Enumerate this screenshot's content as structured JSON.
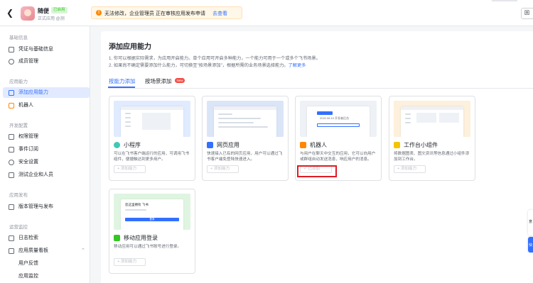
{
  "header": {
    "back_icon": "back-icon",
    "app_name": "随便",
    "app_badge": "已启用",
    "app_sub": "正式应用  @测",
    "banner_text": "无法修改，企业管理员 正在审核应用发布申请",
    "banner_link": "去查看",
    "right_button": "回"
  },
  "sidebar": {
    "groups": {
      "basic": "基础信息",
      "capability": "应用能力",
      "dev": "开发配置",
      "release": "应用发布",
      "ops": "运营监控"
    },
    "items": [
      {
        "label": "凭证与基础信息"
      },
      {
        "label": "成员管理"
      },
      {
        "label": "添加应用能力"
      },
      {
        "label": "机器人"
      },
      {
        "label": "权限管理"
      },
      {
        "label": "事件订阅"
      },
      {
        "label": "安全设置"
      },
      {
        "label": "测试企业和人员"
      },
      {
        "label": "版本管理与发布"
      },
      {
        "label": "日志检索"
      },
      {
        "label": "应用质量看板"
      },
      {
        "label": "用户反馈"
      },
      {
        "label": "应用监控"
      }
    ]
  },
  "main": {
    "title": "添加应用能力",
    "desc1": "1. 你可以根据实际需求，为应用开启能力。单个应用可开启多种能力，一个能力可用于一个或多个飞书场景。",
    "desc2": "2. 如果尚不确定需要添加什么能力，可切换至\"按场景添加\"，根据所需的业务场景选择能力。",
    "desc2_link": "了解更多",
    "tabs": [
      {
        "label": "按能力添加"
      },
      {
        "label": "按场景添加"
      }
    ],
    "new_badge": "New",
    "cards": [
      {
        "title": "小程序",
        "desc": "可以在飞书客户端运行的应用，可调用飞书组件，便捷触达到更多用户。",
        "button": "+ 添加能力"
      },
      {
        "title": "网页应用",
        "desc": "快速接入已有的网页应用，用户可以通过飞书客户端免登陆快速进入。",
        "button": "+ 添加能力"
      },
      {
        "title": "机器人",
        "desc": "与用户在聊天中交互的应用，它可以向用户或群组自动发送消息，响应用户的消息。",
        "button": "✓ 已添加",
        "img_title": "吃饭了吗",
        "img_line": "2022.06.10 开发者后台"
      },
      {
        "title": "工作台小组件",
        "desc": "将数据图表、图文资讯等信息通过小组件添加到工作台。",
        "button": "+ 添加能力"
      },
      {
        "title": "移动应用登录",
        "desc": "移动应用可以通过飞书账号进行登录。",
        "button": "+ 添加能力",
        "img_title": "您这里拥有 飞书",
        "img_btn": "登录"
      }
    ]
  },
  "floating": {
    "tab1": "意",
    "tab2": "快"
  },
  "colors": {
    "accent": "#3370ff",
    "warning": "#ff8800",
    "highlight_box": "#e01b24"
  }
}
